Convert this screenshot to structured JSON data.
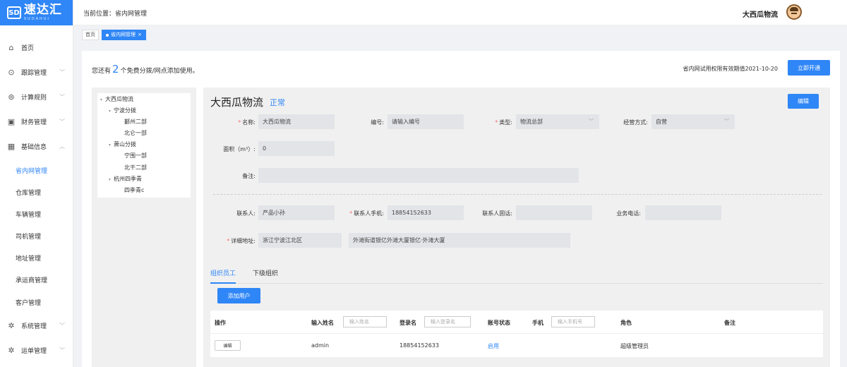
{
  "logo": {
    "text": "速达汇",
    "sub": "SUDAHUI",
    "mark": "SD"
  },
  "sidebar": {
    "items": [
      {
        "label": "首页",
        "icon": "home-icon",
        "glyph": "⌂",
        "chevron": ""
      },
      {
        "label": "跟踪管理",
        "icon": "location-pin-icon",
        "glyph": "⊙",
        "chevron": "﹀"
      },
      {
        "label": "计算规则",
        "icon": "map-pin-icon",
        "glyph": "⊚",
        "chevron": "﹀"
      },
      {
        "label": "财务管理",
        "icon": "wallet-icon",
        "glyph": "▣",
        "chevron": "﹀"
      },
      {
        "label": "基础信息",
        "icon": "grid-icon",
        "glyph": "▦",
        "chevron": "︿"
      }
    ],
    "sub_items": [
      "省内网管理",
      "仓库管理",
      "车辆管理",
      "司机管理",
      "地址管理",
      "承运商管理",
      "客户管理"
    ],
    "bottom_items": [
      {
        "label": "系统管理",
        "icon": "gear-icon",
        "glyph": "✲",
        "chevron": "﹀"
      },
      {
        "label": "运单管理",
        "icon": "settings-icon",
        "glyph": "✲",
        "chevron": "﹀"
      }
    ]
  },
  "header": {
    "breadcrumb": "当前位置：省内网管理",
    "company": "大西瓜物流"
  },
  "tabs": {
    "home": "首页",
    "active": "省内网管理",
    "close": "×"
  },
  "notice": {
    "prefix": "您还有",
    "count": "2",
    "suffix": "个免费分拨/网点添加使用。"
  },
  "validity": "省内网试用权限有效期值2021-10-20",
  "open_button": "立即开通",
  "tree": [
    {
      "label": "大西瓜物流",
      "arrow": "▾"
    },
    {
      "label": "宁波分拨",
      "arrow": "▾"
    },
    {
      "label": "鄞州二部",
      "arrow": ""
    },
    {
      "label": "北仑一部",
      "arrow": ""
    },
    {
      "label": "萧山分拨",
      "arrow": "▾"
    },
    {
      "label": "宁围一部",
      "arrow": ""
    },
    {
      "label": "北干二部",
      "arrow": ""
    },
    {
      "label": "杭州四季青",
      "arrow": "▾"
    },
    {
      "label": "四季青c",
      "arrow": ""
    }
  ],
  "detail": {
    "title": "大西瓜物流",
    "status": "正常",
    "edit_button": "编辑",
    "fields": {
      "name_label": "名称:",
      "name_value": "大西瓜物流",
      "code_label": "编号:",
      "code_placeholder": "请输入编号",
      "type_label": "类型:",
      "type_value": "物流总部",
      "mode_label": "经营方式:",
      "mode_value": "自营",
      "area_label": "面积（m³）:",
      "area_value": "0",
      "remark_label": "备注:",
      "remark_value": "",
      "contact_label": "联系人:",
      "contact_value": "产品小孙",
      "phone_label": "联系人手机:",
      "phone_value": "18854152633",
      "landline_label": "联系人固话:",
      "landline_value": "",
      "bizphone_label": "业务电话:",
      "bizphone_value": "",
      "address_label": "详细地址:",
      "address_region": "浙江宁波江北区",
      "address_detail": "外滩街道银亿外滩大厦银亿·外滩大厦"
    },
    "select_arrow": "﹀",
    "subtabs": [
      "组织员工",
      "下级组织"
    ],
    "add_user": "添加用户"
  },
  "table": {
    "headers": {
      "action": "操作",
      "name": "输入姓名",
      "name_ph": "输入姓名",
      "login": "登录名",
      "login_ph": "输入登录名",
      "status": "账号状态",
      "phone": "手机",
      "phone_ph": "输入手机号",
      "role": "角色",
      "remark": "备注"
    },
    "rows": [
      {
        "edit": "编辑",
        "name": "admin",
        "login": "18854152633",
        "status": "启用",
        "role": "超级管理员",
        "remark": ""
      }
    ]
  },
  "colors": {
    "primary": "#2f86f6",
    "required": "#f56c6c"
  }
}
